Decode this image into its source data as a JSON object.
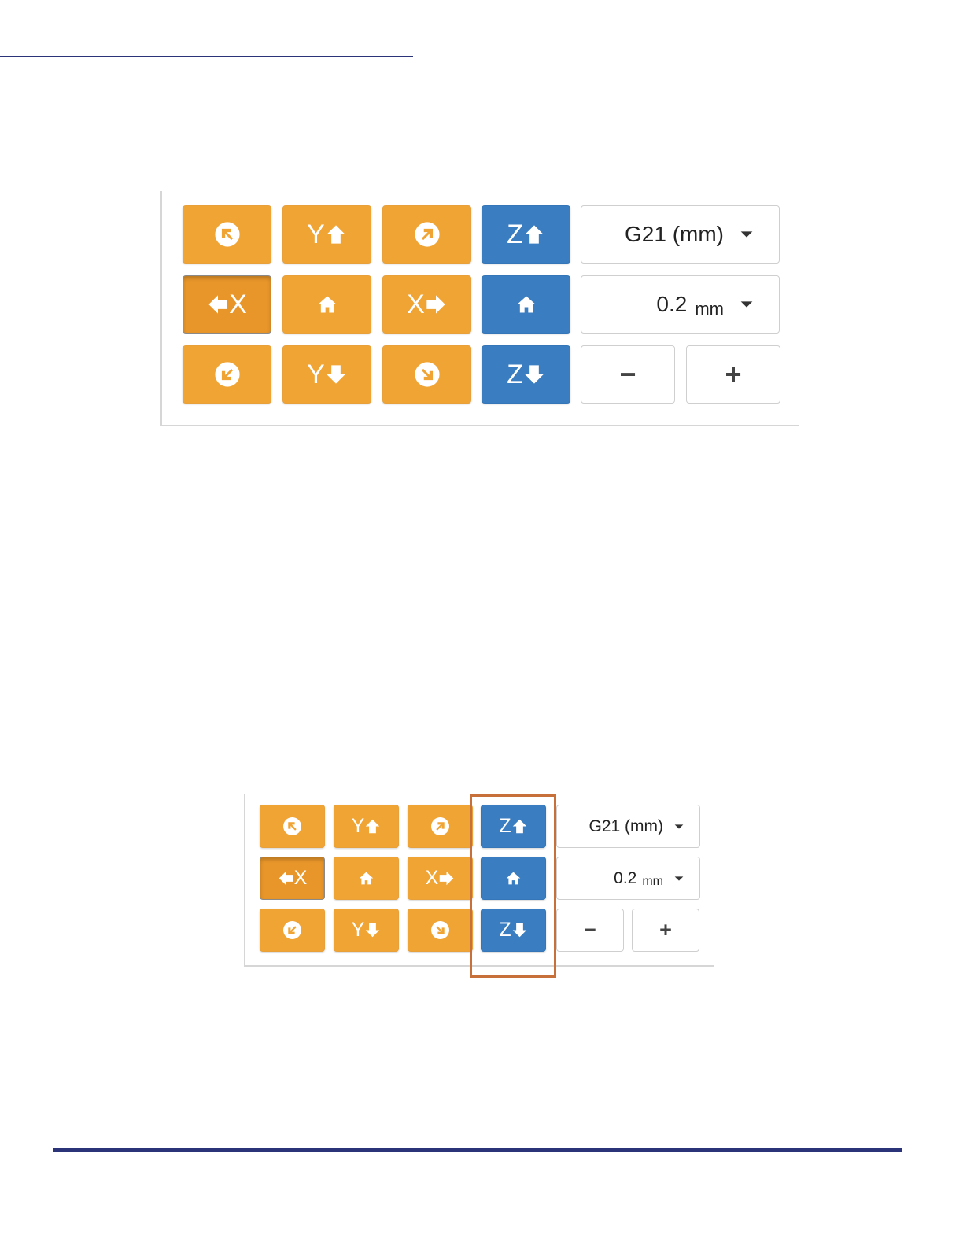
{
  "jog": {
    "y_plus": "Y",
    "y_minus": "Y",
    "x_minus": "X",
    "x_plus": "X",
    "z_plus": "Z",
    "z_minus": "Z"
  },
  "units_select": {
    "value": "G21 (mm)"
  },
  "step_select": {
    "value": "0.2",
    "unit": "mm"
  },
  "step_controls": {
    "decrease": "−",
    "increase": "+"
  },
  "colors": {
    "xy_buttons": "#f0a434",
    "z_buttons": "#3a7dc1",
    "highlight_box": "#c8703a",
    "rules": "#2b3478"
  },
  "icons": {
    "diag_up_left": "arrow-up-left-circle-icon",
    "diag_up_right": "arrow-up-right-circle-icon",
    "diag_down_left": "arrow-down-left-circle-icon",
    "diag_down_right": "arrow-down-right-circle-icon",
    "home": "home-icon",
    "caret": "caret-down-icon"
  }
}
